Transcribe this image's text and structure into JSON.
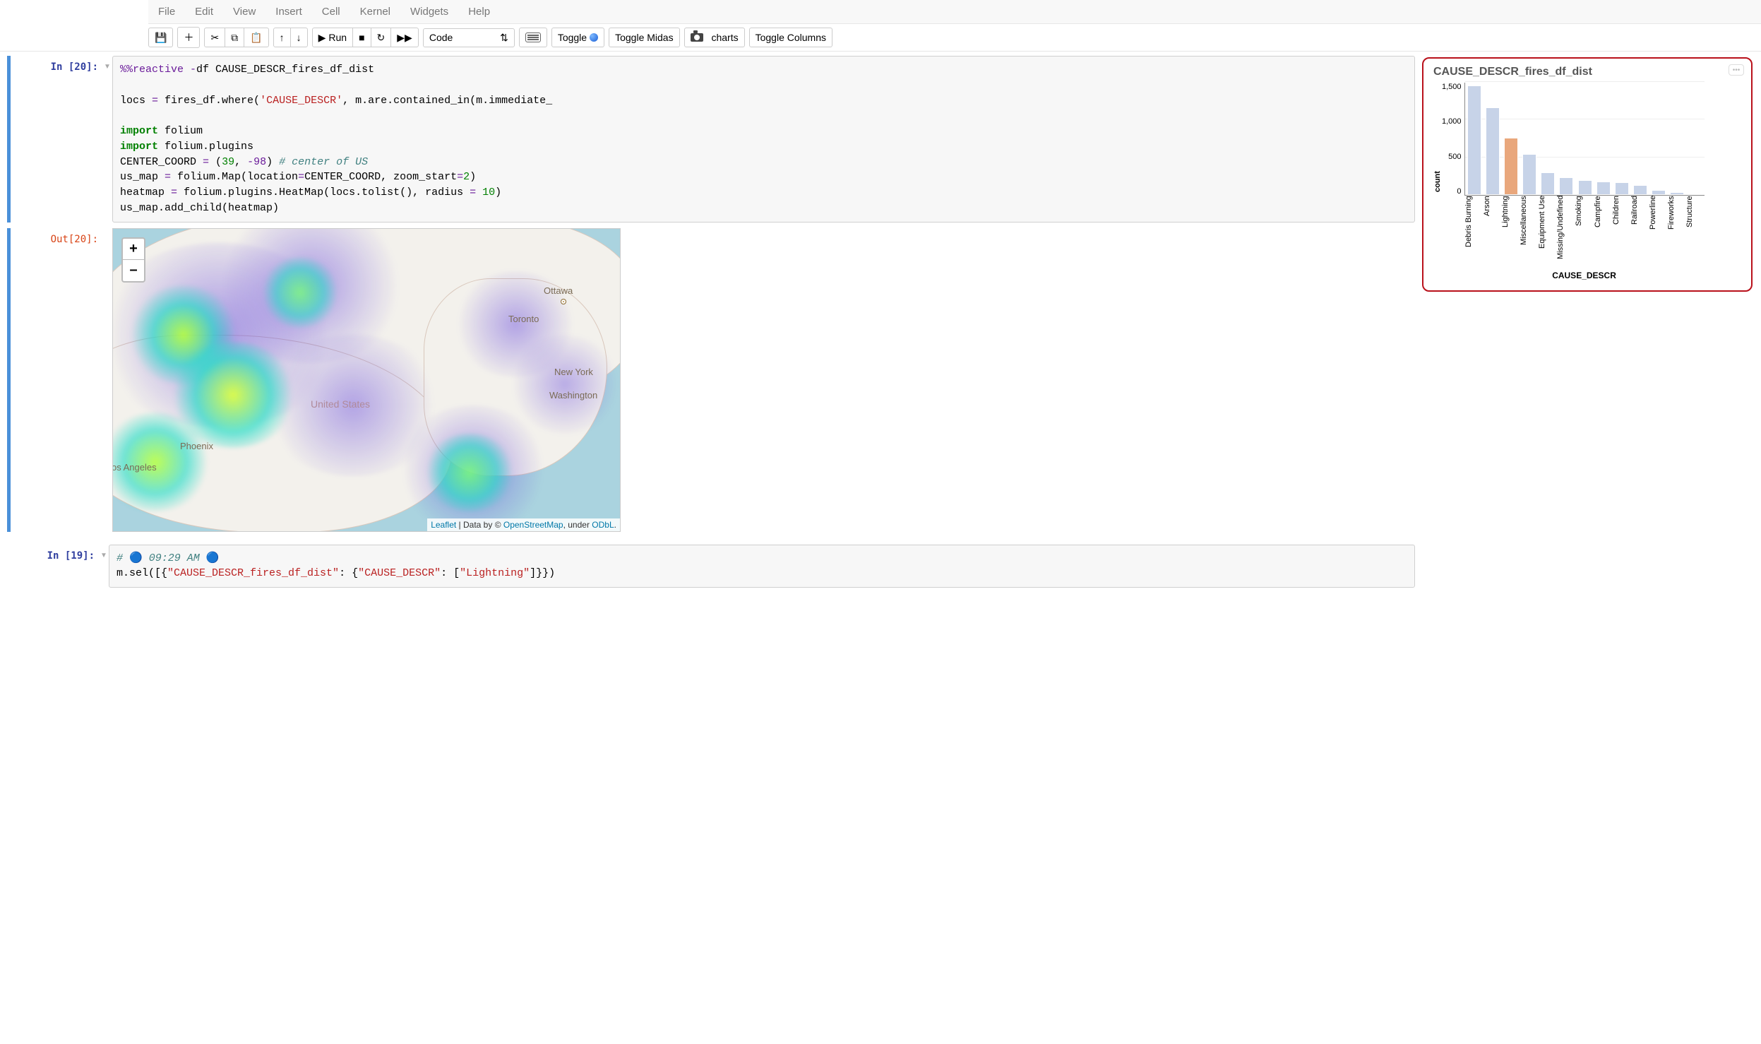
{
  "menus": {
    "file": "File",
    "edit": "Edit",
    "view": "View",
    "insert": "Insert",
    "cell": "Cell",
    "kernel": "Kernel",
    "widgets": "Widgets",
    "help": "Help"
  },
  "toolbar": {
    "run_label": "Run",
    "celltype": "Code",
    "toggle": "Toggle",
    "toggle_midas": "Toggle Midas",
    "charts": "charts",
    "toggle_columns": "Toggle Columns"
  },
  "cells": {
    "c20": {
      "in_prompt": "In [20]:",
      "out_prompt": "Out[20]:",
      "code": {
        "l1a": "%%reactive ",
        "l1b": "-",
        "l1c": "df CAUSE_DESCR_fires_df_dist",
        "l2": "",
        "l3a": "locs ",
        "l3b": "=",
        "l3c": " fires_df.where(",
        "l3d": "'CAUSE_DESCR'",
        "l3e": ", m.are.contained_in(m.immediate_",
        "l4": "",
        "l5a": "import",
        "l5b": " folium",
        "l6a": "import",
        "l6b": " folium.plugins",
        "l7a": "CENTER_COORD ",
        "l7b": "=",
        "l7c": " (",
        "l7d": "39",
        "l7e": ", ",
        "l7f": "-98",
        "l7g": ") ",
        "l7h": "# center of US",
        "l8a": "us_map ",
        "l8b": "=",
        "l8c": " folium.Map(location",
        "l8d": "=",
        "l8e": "CENTER_COORD, zoom_start",
        "l8f": "=",
        "l8g": "2",
        "l8h": ")",
        "l9a": "heatmap ",
        "l9b": "=",
        "l9c": " folium.plugins.HeatMap(locs.tolist(), radius ",
        "l9d": "=",
        "l9e": " ",
        "l9f": "10",
        "l9g": ")",
        "l10": "us_map.add_child(heatmap)"
      },
      "map": {
        "zoom_in": "+",
        "zoom_out": "–",
        "labels": {
          "ottawa": "Ottawa",
          "toronto": "Toronto",
          "newyork": "New York",
          "washington": "Washington",
          "phoenix": "Phoenix",
          "losangeles": "os Angeles",
          "us": "United States"
        },
        "attr_leaflet": "Leaflet",
        "attr_sep": " | Data by © ",
        "attr_osm": "OpenStreetMap",
        "attr_mid": ", under ",
        "attr_odbl": "ODbL",
        "attr_end": "."
      }
    },
    "c19": {
      "in_prompt": "In [19]:",
      "code": {
        "l1a": "# ",
        "l1b": "🔵",
        "l1c": " 09:29 AM ",
        "l1d": "🔵",
        "l2a": "m.sel([{",
        "l2b": "\"CAUSE_DESCR_fires_df_dist\"",
        "l2c": ": {",
        "l2d": "\"CAUSE_DESCR\"",
        "l2e": ": [",
        "l2f": "\"Lightning\"",
        "l2g": "]}})"
      }
    }
  },
  "sidepanel": {
    "title": "CAUSE_DESCR_fires_df_dist",
    "xlabel": "CAUSE_DESCR",
    "ylabel": "count"
  },
  "chart_data": {
    "type": "bar",
    "title": "CAUSE_DESCR_fires_df_dist",
    "xlabel": "CAUSE_DESCR",
    "ylabel": "count",
    "ylim": [
      0,
      1500
    ],
    "y_ticks": [
      "1,500",
      "1,000",
      "500",
      "0"
    ],
    "categories": [
      "Debris Burning",
      "Arson",
      "Lightning",
      "Miscellaneous",
      "Equipment Use",
      "Missing/Undefined",
      "Smoking",
      "Campfire",
      "Children",
      "Railroad",
      "Powerline",
      "Fireworks",
      "Structure"
    ],
    "values": [
      1450,
      1160,
      760,
      540,
      300,
      230,
      200,
      180,
      170,
      130,
      65,
      40,
      20
    ],
    "highlight_index": 2
  }
}
